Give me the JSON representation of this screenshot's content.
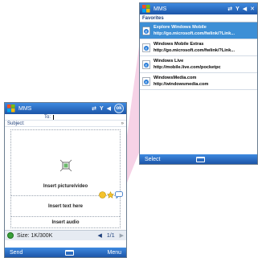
{
  "compose": {
    "app_title": "MMS",
    "ok_label": "ok",
    "to_label": "To:",
    "subject_label": "Subject:",
    "insert_picture_label": "Insert picture/video",
    "insert_text_label": "Insert text here",
    "insert_audio_label": "Insert audio",
    "size_text": "Size: 1K/300K",
    "page_text": "1/1",
    "left_softkey": "Send",
    "right_softkey": "Menu"
  },
  "favorites": {
    "app_title": "MMS",
    "header": "Favorites",
    "items": [
      {
        "name": "Explore Windows Mobile",
        "url": "http://go.microsoft.com/fwlink/?Link...",
        "selected": true
      },
      {
        "name": "Windows Mobile Extras",
        "url": "http://go.microsoft.com/fwlink/?Link...",
        "selected": false
      },
      {
        "name": "Windows Live",
        "url": "http://mobile.live.com/pocketpc",
        "selected": false
      },
      {
        "name": "WindowsMedia.com",
        "url": "http://windowsmedia.com",
        "selected": false
      }
    ],
    "left_softkey": "Select"
  },
  "colors": {
    "title_bar": "#1c55a8",
    "selection": "#3d8fd6",
    "callout": "#f2c8e0"
  }
}
